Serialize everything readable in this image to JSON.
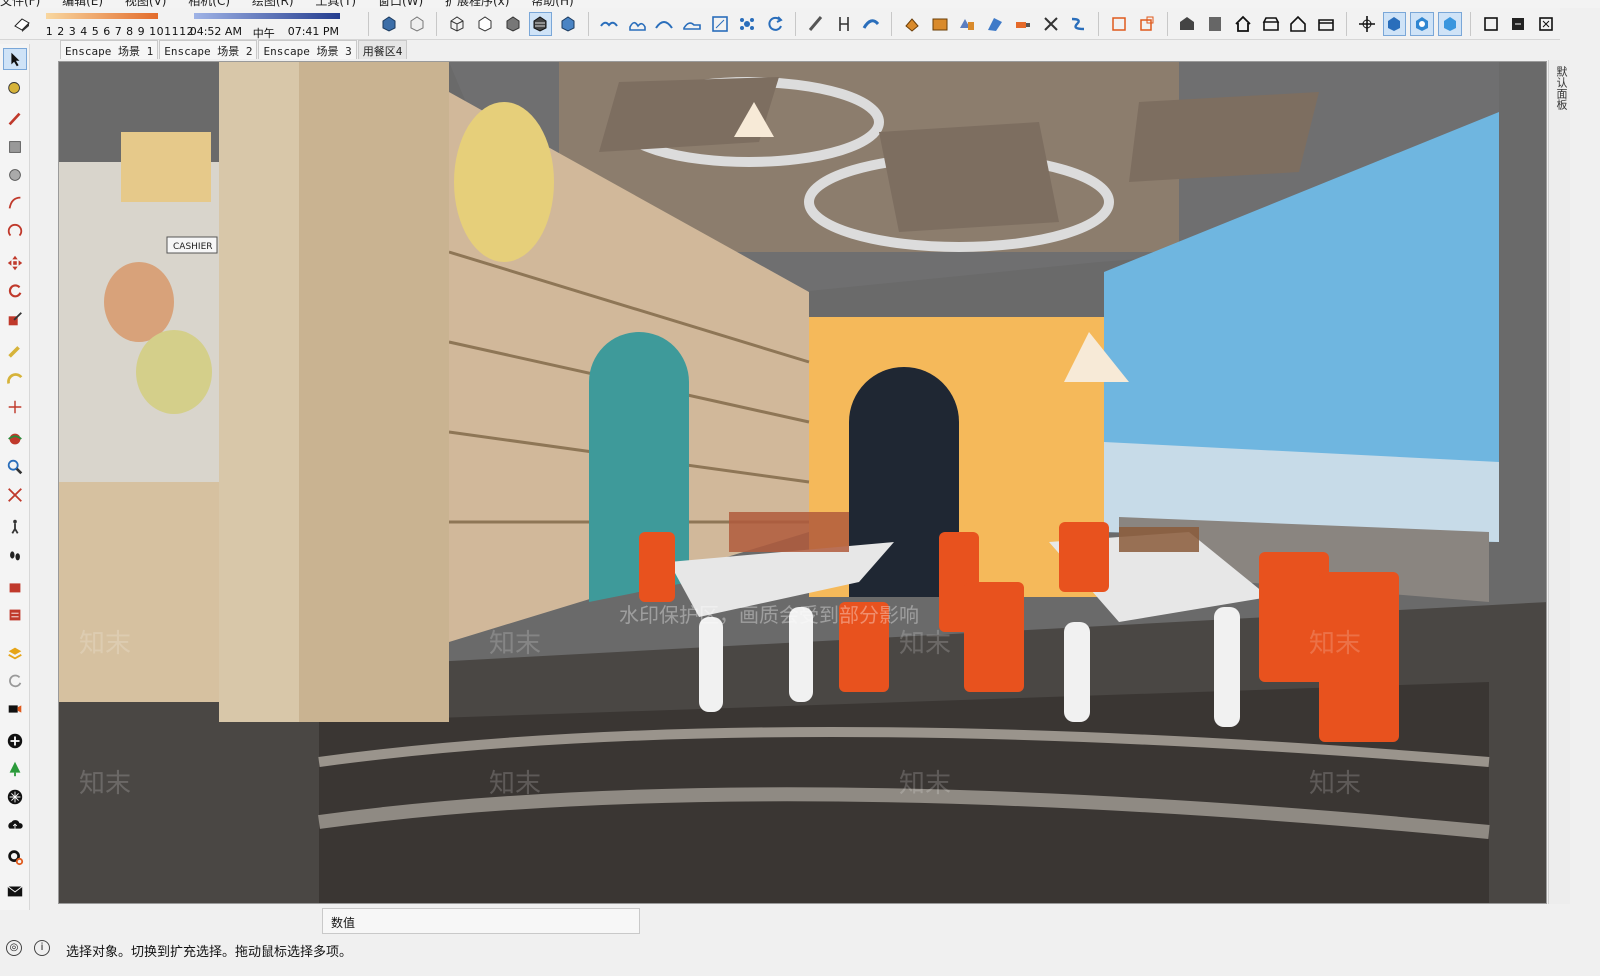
{
  "menu": {
    "items": [
      "文件(F)",
      "编辑(E)",
      "视图(V)",
      "相机(C)",
      "绘图(R)",
      "工具(T)",
      "窗口(W)",
      "扩展程序(x)",
      "帮助(H)"
    ]
  },
  "shadow": {
    "months": "1 2 3 4 5 6 7 8 9 101112",
    "sunrise": "04:52 AM",
    "noon": "中午",
    "sunset": "07:41 PM"
  },
  "scene_tabs": [
    {
      "label": "Enscape 场景 1"
    },
    {
      "label": "Enscape 场景 2"
    },
    {
      "label": "Enscape 场景 3"
    },
    {
      "label": "用餐区4"
    }
  ],
  "tray": {
    "label": "默认面板"
  },
  "viewport": {
    "cashier_sign": "CASHIER",
    "watermark_banner": "水印保护区，画质会受到部分影响",
    "watermark_brand": "知末"
  },
  "measurements": {
    "label": "数值"
  },
  "status": {
    "text": "选择对象。切换到扩充选择。拖动鼠标选择多项。"
  },
  "colors": {
    "accent": "#2a6ebb",
    "chair": "#e8521e",
    "wall_yellow": "#f5b95a",
    "sky": "#6fb6e0"
  }
}
